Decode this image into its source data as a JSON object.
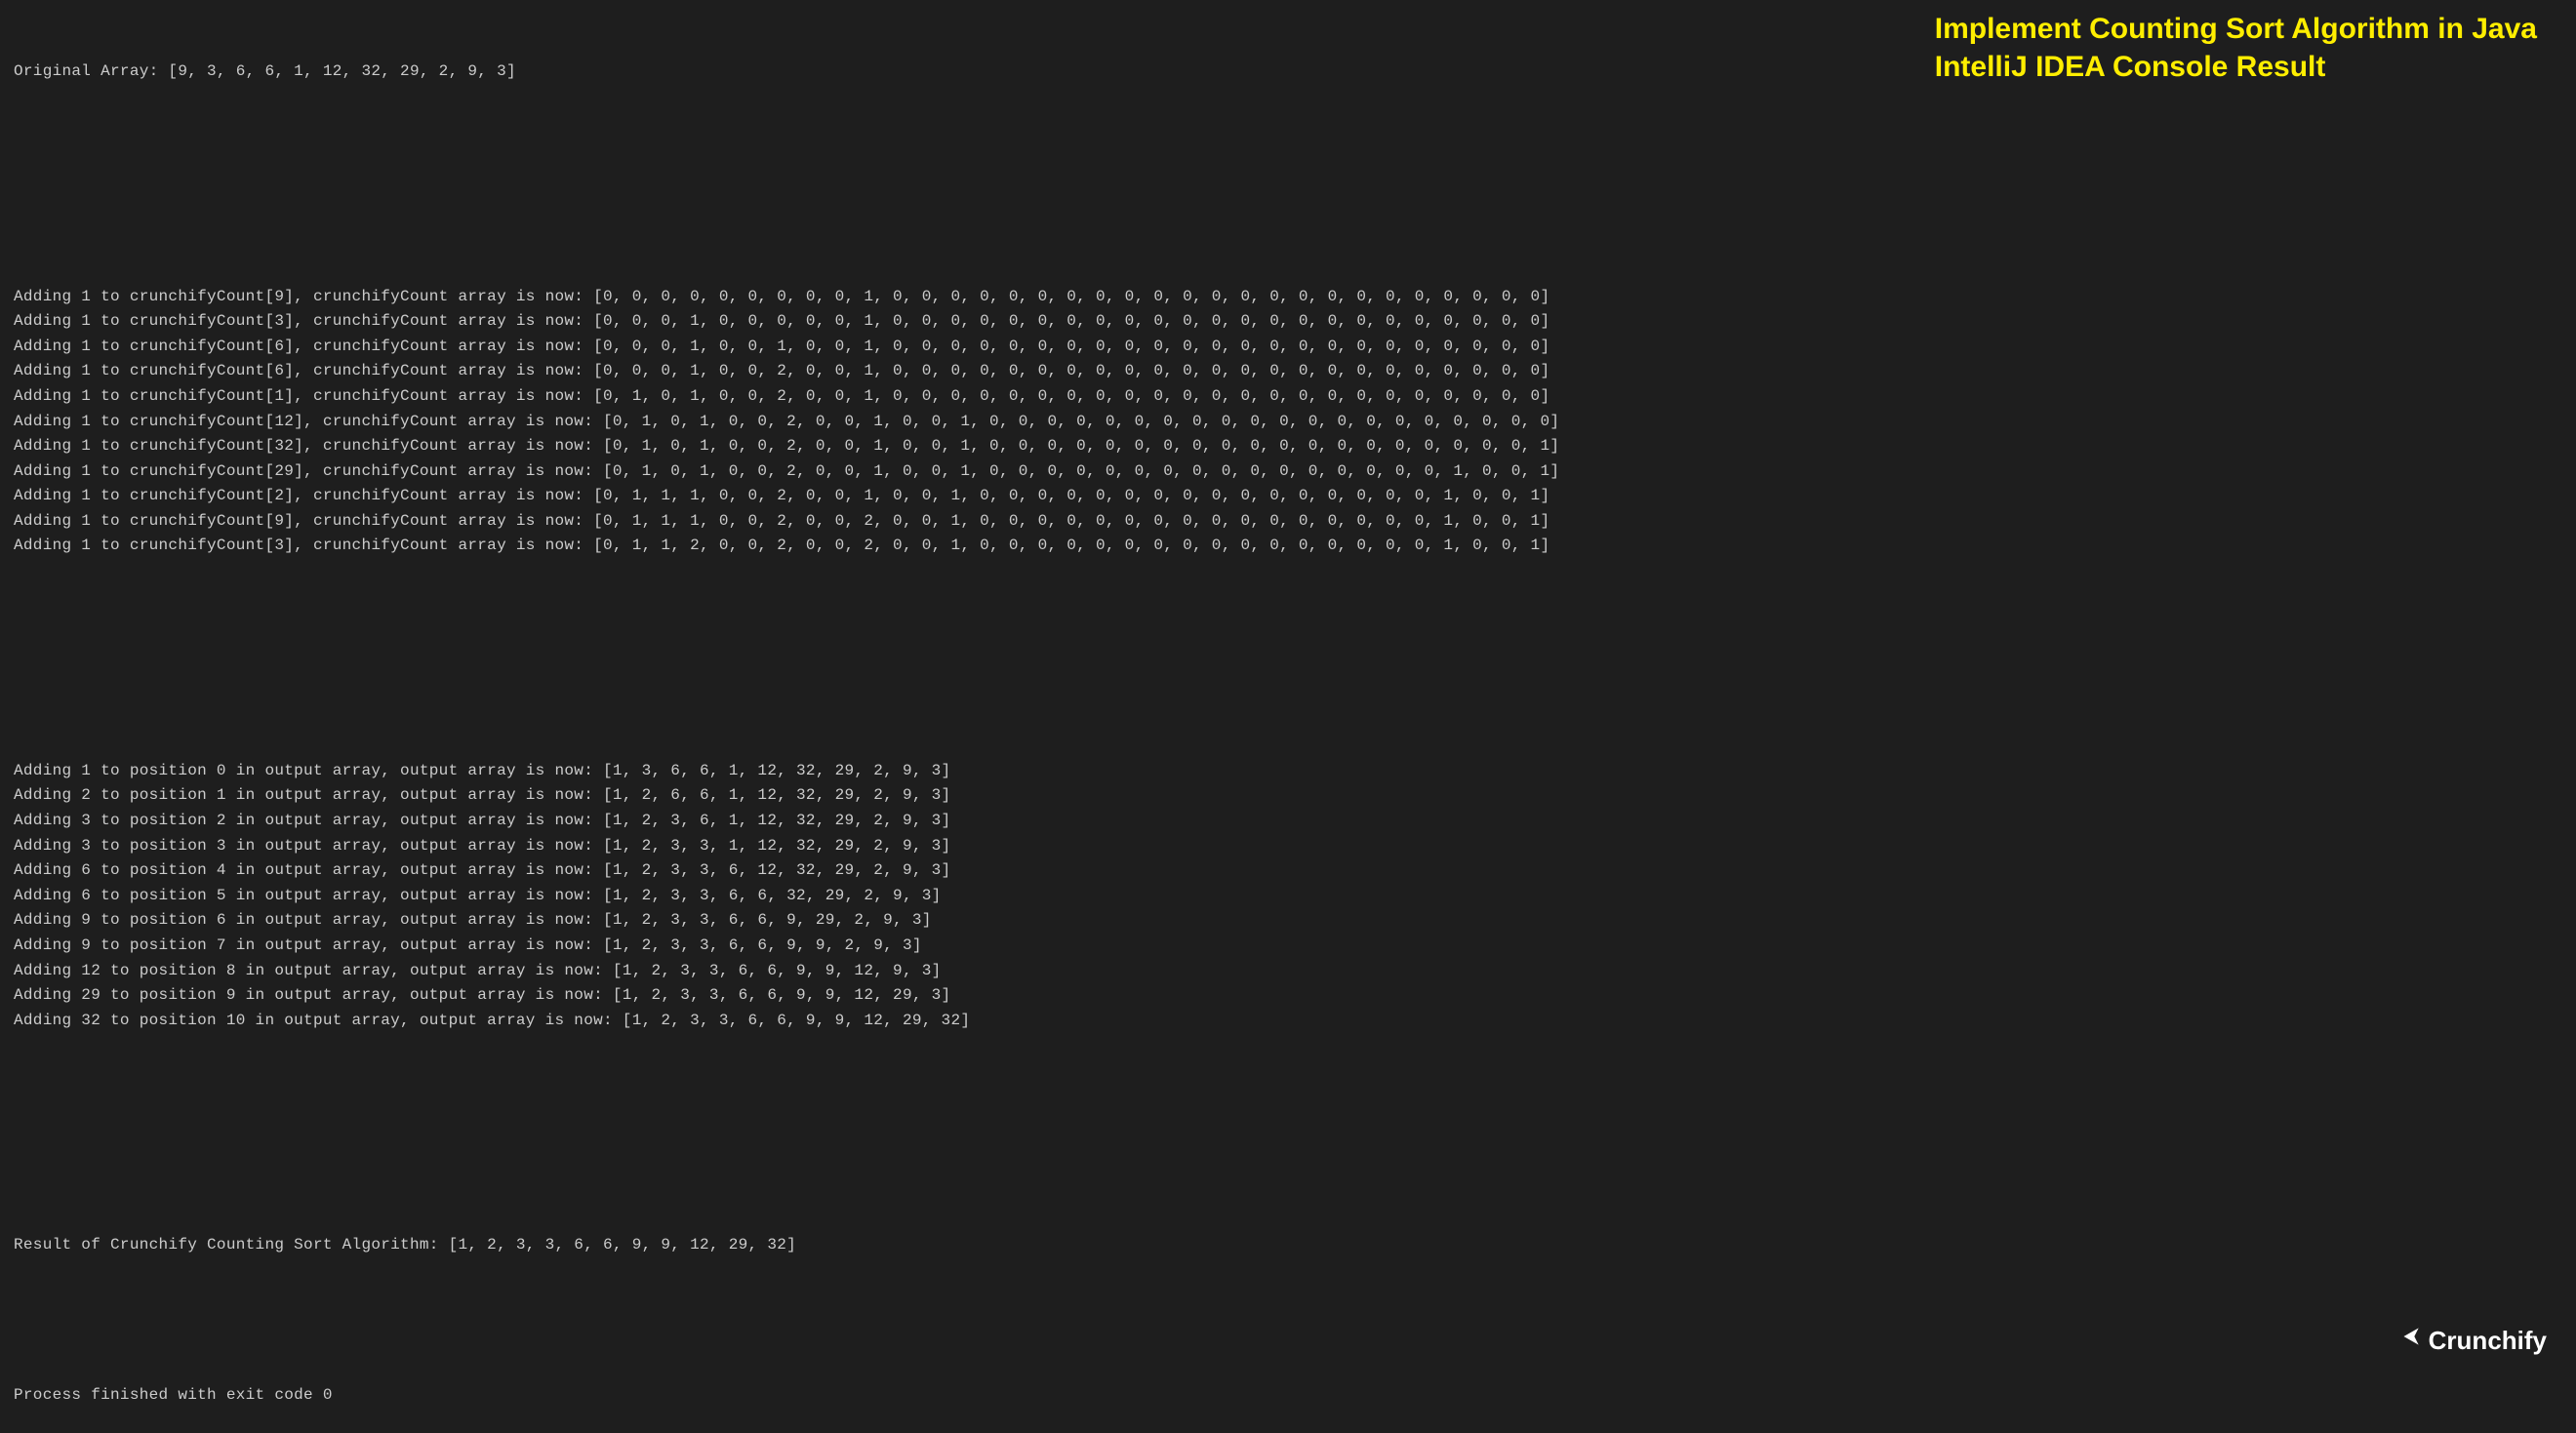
{
  "title_overlay": {
    "line1": "Implement Counting Sort Algorithm in Java",
    "line2": "IntelliJ IDEA Console Result"
  },
  "logo": {
    "text": "Crunchify"
  },
  "console": {
    "original_array": "Original Array: [9, 3, 6, 6, 1, 12, 32, 29, 2, 9, 3]",
    "count_steps": [
      "Adding 1 to crunchifyCount[9], crunchifyCount array is now: [0, 0, 0, 0, 0, 0, 0, 0, 0, 1, 0, 0, 0, 0, 0, 0, 0, 0, 0, 0, 0, 0, 0, 0, 0, 0, 0, 0, 0, 0, 0, 0, 0]",
      "Adding 1 to crunchifyCount[3], crunchifyCount array is now: [0, 0, 0, 1, 0, 0, 0, 0, 0, 1, 0, 0, 0, 0, 0, 0, 0, 0, 0, 0, 0, 0, 0, 0, 0, 0, 0, 0, 0, 0, 0, 0, 0]",
      "Adding 1 to crunchifyCount[6], crunchifyCount array is now: [0, 0, 0, 1, 0, 0, 1, 0, 0, 1, 0, 0, 0, 0, 0, 0, 0, 0, 0, 0, 0, 0, 0, 0, 0, 0, 0, 0, 0, 0, 0, 0, 0]",
      "Adding 1 to crunchifyCount[6], crunchifyCount array is now: [0, 0, 0, 1, 0, 0, 2, 0, 0, 1, 0, 0, 0, 0, 0, 0, 0, 0, 0, 0, 0, 0, 0, 0, 0, 0, 0, 0, 0, 0, 0, 0, 0]",
      "Adding 1 to crunchifyCount[1], crunchifyCount array is now: [0, 1, 0, 1, 0, 0, 2, 0, 0, 1, 0, 0, 0, 0, 0, 0, 0, 0, 0, 0, 0, 0, 0, 0, 0, 0, 0, 0, 0, 0, 0, 0, 0]",
      "Adding 1 to crunchifyCount[12], crunchifyCount array is now: [0, 1, 0, 1, 0, 0, 2, 0, 0, 1, 0, 0, 1, 0, 0, 0, 0, 0, 0, 0, 0, 0, 0, 0, 0, 0, 0, 0, 0, 0, 0, 0, 0]",
      "Adding 1 to crunchifyCount[32], crunchifyCount array is now: [0, 1, 0, 1, 0, 0, 2, 0, 0, 1, 0, 0, 1, 0, 0, 0, 0, 0, 0, 0, 0, 0, 0, 0, 0, 0, 0, 0, 0, 0, 0, 0, 1]",
      "Adding 1 to crunchifyCount[29], crunchifyCount array is now: [0, 1, 0, 1, 0, 0, 2, 0, 0, 1, 0, 0, 1, 0, 0, 0, 0, 0, 0, 0, 0, 0, 0, 0, 0, 0, 0, 0, 0, 1, 0, 0, 1]",
      "Adding 1 to crunchifyCount[2], crunchifyCount array is now: [0, 1, 1, 1, 0, 0, 2, 0, 0, 1, 0, 0, 1, 0, 0, 0, 0, 0, 0, 0, 0, 0, 0, 0, 0, 0, 0, 0, 0, 1, 0, 0, 1]",
      "Adding 1 to crunchifyCount[9], crunchifyCount array is now: [0, 1, 1, 1, 0, 0, 2, 0, 0, 2, 0, 0, 1, 0, 0, 0, 0, 0, 0, 0, 0, 0, 0, 0, 0, 0, 0, 0, 0, 1, 0, 0, 1]",
      "Adding 1 to crunchifyCount[3], crunchifyCount array is now: [0, 1, 1, 2, 0, 0, 2, 0, 0, 2, 0, 0, 1, 0, 0, 0, 0, 0, 0, 0, 0, 0, 0, 0, 0, 0, 0, 0, 0, 1, 0, 0, 1]"
    ],
    "output_steps": [
      "Adding 1 to position 0 in output array, output array is now: [1, 3, 6, 6, 1, 12, 32, 29, 2, 9, 3]",
      "Adding 2 to position 1 in output array, output array is now: [1, 2, 6, 6, 1, 12, 32, 29, 2, 9, 3]",
      "Adding 3 to position 2 in output array, output array is now: [1, 2, 3, 6, 1, 12, 32, 29, 2, 9, 3]",
      "Adding 3 to position 3 in output array, output array is now: [1, 2, 3, 3, 1, 12, 32, 29, 2, 9, 3]",
      "Adding 6 to position 4 in output array, output array is now: [1, 2, 3, 3, 6, 12, 32, 29, 2, 9, 3]",
      "Adding 6 to position 5 in output array, output array is now: [1, 2, 3, 3, 6, 6, 32, 29, 2, 9, 3]",
      "Adding 9 to position 6 in output array, output array is now: [1, 2, 3, 3, 6, 6, 9, 29, 2, 9, 3]",
      "Adding 9 to position 7 in output array, output array is now: [1, 2, 3, 3, 6, 6, 9, 9, 2, 9, 3]",
      "Adding 12 to position 8 in output array, output array is now: [1, 2, 3, 3, 6, 6, 9, 9, 12, 9, 3]",
      "Adding 29 to position 9 in output array, output array is now: [1, 2, 3, 3, 6, 6, 9, 9, 12, 29, 3]",
      "Adding 32 to position 10 in output array, output array is now: [1, 2, 3, 3, 6, 6, 9, 9, 12, 29, 32]"
    ],
    "result_line": "Result of Crunchify Counting Sort Algorithm: [1, 2, 3, 3, 6, 6, 9, 9, 12, 29, 32]",
    "exit_line": "Process finished with exit code 0"
  }
}
